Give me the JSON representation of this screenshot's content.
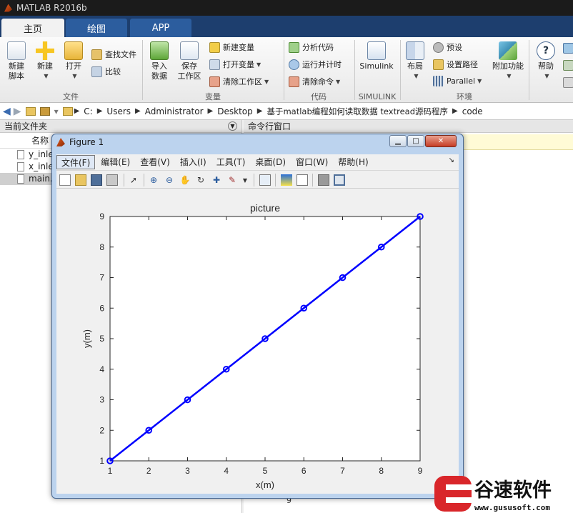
{
  "app": {
    "title": "MATLAB R2016b"
  },
  "tabs": [
    {
      "label": "主页",
      "active": true
    },
    {
      "label": "绘图",
      "active": false
    },
    {
      "label": "APP",
      "active": false
    }
  ],
  "ribbon": {
    "groups": {
      "file": "文件",
      "variable": "变量",
      "code": "代码",
      "simulink": "SIMULINK",
      "environment": "环境"
    },
    "new_script": "新建\n脚本",
    "new_script_l1": "新建",
    "new_script_l2": "脚本",
    "new": "新建",
    "open": "打开",
    "find_files": "查找文件",
    "compare": "比较",
    "import_l1": "导入",
    "import_l2": "数据",
    "save_l1": "保存",
    "save_l2": "工作区",
    "new_variable": "新建变量",
    "open_variable": "打开变量",
    "clear_workspace": "清除工作区",
    "analyze_code": "分析代码",
    "run_time": "运行并计时",
    "clear_commands": "清除命令",
    "simulink": "Simulink",
    "layout": "布局",
    "preferences": "预设",
    "set_path": "设置路径",
    "parallel": "Parallel",
    "addons": "附加功能",
    "help": "帮助"
  },
  "address": {
    "crumbs": [
      "C:",
      "Users",
      "Administrator",
      "Desktop",
      "基于matlab编程如何读取数据 textread源码程序",
      "code"
    ]
  },
  "left_panel": {
    "title": "当前文件夹",
    "column_name": "名称",
    "files": [
      {
        "name": "y_inle",
        "selected": false
      },
      {
        "name": "x_inle",
        "selected": false
      },
      {
        "name": "main.",
        "selected": true
      }
    ]
  },
  "right_panel": {
    "title": "命令行窗口",
    "bottom_digit": "9"
  },
  "figure": {
    "title": "Figure 1",
    "menu": [
      {
        "label": "文件(F)",
        "active": true
      },
      {
        "label": "编辑(E)",
        "active": false
      },
      {
        "label": "查看(V)",
        "active": false
      },
      {
        "label": "插入(I)",
        "active": false
      },
      {
        "label": "工具(T)",
        "active": false
      },
      {
        "label": "桌面(D)",
        "active": false
      },
      {
        "label": "窗口(W)",
        "active": false
      },
      {
        "label": "帮助(H)",
        "active": false
      }
    ]
  },
  "chart_data": {
    "type": "line",
    "title": "picture",
    "xlabel": "x(m)",
    "ylabel": "y(m)",
    "x": [
      1,
      2,
      3,
      4,
      5,
      6,
      7,
      8,
      9
    ],
    "series": [
      {
        "values": [
          1,
          2,
          3,
          4,
          5,
          6,
          7,
          8,
          9
        ],
        "color": "#0000ff",
        "marker": "circle"
      }
    ],
    "xlim": [
      1,
      9
    ],
    "ylim": [
      1,
      9
    ],
    "xticks": [
      1,
      2,
      3,
      4,
      5,
      6,
      7,
      8,
      9
    ],
    "yticks": [
      1,
      2,
      3,
      4,
      5,
      6,
      7,
      8,
      9
    ],
    "grid": false
  },
  "watermark": {
    "cn": "谷速软件",
    "url": "www.gususoft.com"
  },
  "colors": {
    "tab_bar": "#1d3e6e",
    "line": "#0000ff",
    "watermark_red": "#d9262a"
  }
}
